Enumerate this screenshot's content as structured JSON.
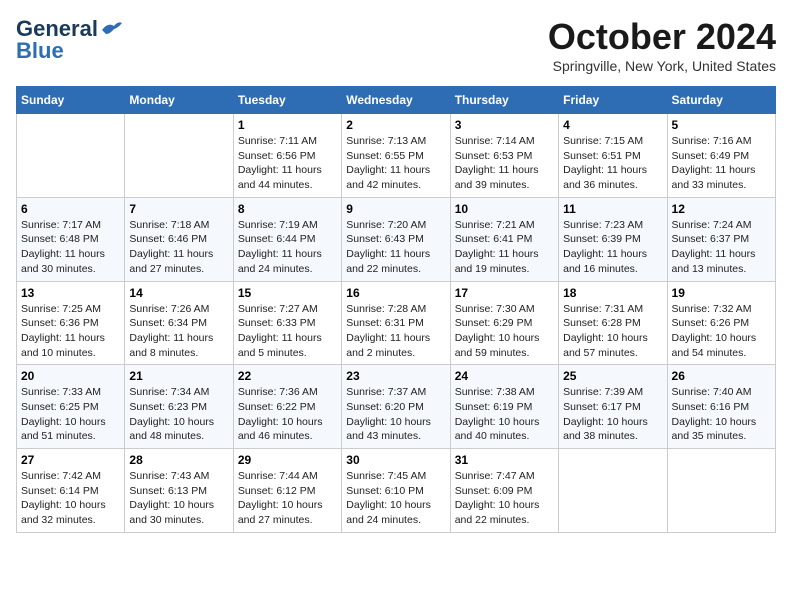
{
  "header": {
    "logo_line1": "General",
    "logo_line2": "Blue",
    "month_title": "October 2024",
    "location": "Springville, New York, United States"
  },
  "days_of_week": [
    "Sunday",
    "Monday",
    "Tuesday",
    "Wednesday",
    "Thursday",
    "Friday",
    "Saturday"
  ],
  "weeks": [
    [
      {
        "day": "",
        "content": ""
      },
      {
        "day": "",
        "content": ""
      },
      {
        "day": "1",
        "content": "Sunrise: 7:11 AM\nSunset: 6:56 PM\nDaylight: 11 hours and 44 minutes."
      },
      {
        "day": "2",
        "content": "Sunrise: 7:13 AM\nSunset: 6:55 PM\nDaylight: 11 hours and 42 minutes."
      },
      {
        "day": "3",
        "content": "Sunrise: 7:14 AM\nSunset: 6:53 PM\nDaylight: 11 hours and 39 minutes."
      },
      {
        "day": "4",
        "content": "Sunrise: 7:15 AM\nSunset: 6:51 PM\nDaylight: 11 hours and 36 minutes."
      },
      {
        "day": "5",
        "content": "Sunrise: 7:16 AM\nSunset: 6:49 PM\nDaylight: 11 hours and 33 minutes."
      }
    ],
    [
      {
        "day": "6",
        "content": "Sunrise: 7:17 AM\nSunset: 6:48 PM\nDaylight: 11 hours and 30 minutes."
      },
      {
        "day": "7",
        "content": "Sunrise: 7:18 AM\nSunset: 6:46 PM\nDaylight: 11 hours and 27 minutes."
      },
      {
        "day": "8",
        "content": "Sunrise: 7:19 AM\nSunset: 6:44 PM\nDaylight: 11 hours and 24 minutes."
      },
      {
        "day": "9",
        "content": "Sunrise: 7:20 AM\nSunset: 6:43 PM\nDaylight: 11 hours and 22 minutes."
      },
      {
        "day": "10",
        "content": "Sunrise: 7:21 AM\nSunset: 6:41 PM\nDaylight: 11 hours and 19 minutes."
      },
      {
        "day": "11",
        "content": "Sunrise: 7:23 AM\nSunset: 6:39 PM\nDaylight: 11 hours and 16 minutes."
      },
      {
        "day": "12",
        "content": "Sunrise: 7:24 AM\nSunset: 6:37 PM\nDaylight: 11 hours and 13 minutes."
      }
    ],
    [
      {
        "day": "13",
        "content": "Sunrise: 7:25 AM\nSunset: 6:36 PM\nDaylight: 11 hours and 10 minutes."
      },
      {
        "day": "14",
        "content": "Sunrise: 7:26 AM\nSunset: 6:34 PM\nDaylight: 11 hours and 8 minutes."
      },
      {
        "day": "15",
        "content": "Sunrise: 7:27 AM\nSunset: 6:33 PM\nDaylight: 11 hours and 5 minutes."
      },
      {
        "day": "16",
        "content": "Sunrise: 7:28 AM\nSunset: 6:31 PM\nDaylight: 11 hours and 2 minutes."
      },
      {
        "day": "17",
        "content": "Sunrise: 7:30 AM\nSunset: 6:29 PM\nDaylight: 10 hours and 59 minutes."
      },
      {
        "day": "18",
        "content": "Sunrise: 7:31 AM\nSunset: 6:28 PM\nDaylight: 10 hours and 57 minutes."
      },
      {
        "day": "19",
        "content": "Sunrise: 7:32 AM\nSunset: 6:26 PM\nDaylight: 10 hours and 54 minutes."
      }
    ],
    [
      {
        "day": "20",
        "content": "Sunrise: 7:33 AM\nSunset: 6:25 PM\nDaylight: 10 hours and 51 minutes."
      },
      {
        "day": "21",
        "content": "Sunrise: 7:34 AM\nSunset: 6:23 PM\nDaylight: 10 hours and 48 minutes."
      },
      {
        "day": "22",
        "content": "Sunrise: 7:36 AM\nSunset: 6:22 PM\nDaylight: 10 hours and 46 minutes."
      },
      {
        "day": "23",
        "content": "Sunrise: 7:37 AM\nSunset: 6:20 PM\nDaylight: 10 hours and 43 minutes."
      },
      {
        "day": "24",
        "content": "Sunrise: 7:38 AM\nSunset: 6:19 PM\nDaylight: 10 hours and 40 minutes."
      },
      {
        "day": "25",
        "content": "Sunrise: 7:39 AM\nSunset: 6:17 PM\nDaylight: 10 hours and 38 minutes."
      },
      {
        "day": "26",
        "content": "Sunrise: 7:40 AM\nSunset: 6:16 PM\nDaylight: 10 hours and 35 minutes."
      }
    ],
    [
      {
        "day": "27",
        "content": "Sunrise: 7:42 AM\nSunset: 6:14 PM\nDaylight: 10 hours and 32 minutes."
      },
      {
        "day": "28",
        "content": "Sunrise: 7:43 AM\nSunset: 6:13 PM\nDaylight: 10 hours and 30 minutes."
      },
      {
        "day": "29",
        "content": "Sunrise: 7:44 AM\nSunset: 6:12 PM\nDaylight: 10 hours and 27 minutes."
      },
      {
        "day": "30",
        "content": "Sunrise: 7:45 AM\nSunset: 6:10 PM\nDaylight: 10 hours and 24 minutes."
      },
      {
        "day": "31",
        "content": "Sunrise: 7:47 AM\nSunset: 6:09 PM\nDaylight: 10 hours and 22 minutes."
      },
      {
        "day": "",
        "content": ""
      },
      {
        "day": "",
        "content": ""
      }
    ]
  ]
}
